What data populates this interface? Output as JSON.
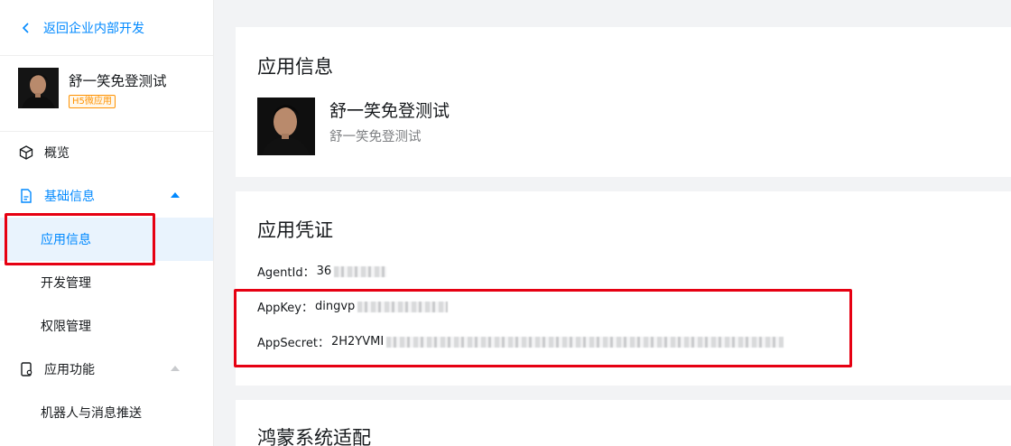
{
  "sidebar": {
    "back_label": "返回企业内部开发",
    "app": {
      "title": "舒一笑免登测试",
      "badge": "H5微应用"
    },
    "items": [
      {
        "label": "概览"
      },
      {
        "label": "基础信息"
      },
      {
        "label": "应用信息"
      },
      {
        "label": "开发管理"
      },
      {
        "label": "权限管理"
      },
      {
        "label": "应用功能"
      },
      {
        "label": "机器人与消息推送"
      }
    ]
  },
  "app_info": {
    "title": "应用信息",
    "name": "舒一笑免登测试",
    "description": "舒一笑免登测试"
  },
  "credentials": {
    "title": "应用凭证",
    "agent_id_label": "AgentId：",
    "agent_id_value": "36",
    "app_key_label": "AppKey：",
    "app_key_value": "dingvp",
    "app_secret_label": "AppSecret：",
    "app_secret_value": "2H2YVMI"
  },
  "harmony": {
    "title": "鸿蒙系统适配"
  },
  "colors": {
    "accent": "#0089ff",
    "highlight": "#e60012",
    "badge": "#ff9200"
  }
}
